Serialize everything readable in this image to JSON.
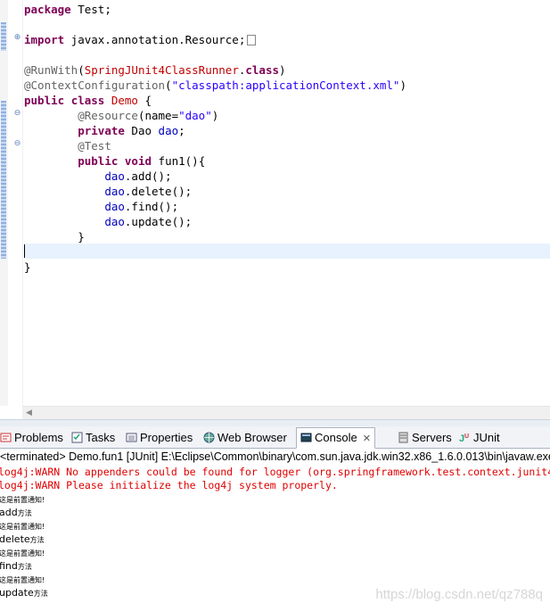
{
  "editor": {
    "lines": [
      {
        "parts": [
          {
            "t": "package",
            "c": "kw"
          },
          {
            "t": " Test;",
            "c": ""
          }
        ]
      },
      {
        "parts": []
      },
      {
        "parts": [
          {
            "t": "import",
            "c": "kw"
          },
          {
            "t": " javax.annotation.Resource;",
            "c": ""
          }
        ],
        "collapsed": true
      },
      {
        "parts": []
      },
      {
        "parts": [
          {
            "t": "@RunWith",
            "c": "an"
          },
          {
            "t": "(",
            "c": ""
          },
          {
            "t": "SpringJUnit4ClassRunner",
            "c": "cls"
          },
          {
            "t": ".",
            "c": ""
          },
          {
            "t": "class",
            "c": "kw"
          },
          {
            "t": ")",
            "c": ""
          }
        ]
      },
      {
        "parts": [
          {
            "t": "@ContextConfiguration",
            "c": "an"
          },
          {
            "t": "(",
            "c": ""
          },
          {
            "t": "\"classpath:applicationContext.xml\"",
            "c": "str"
          },
          {
            "t": ")",
            "c": ""
          }
        ]
      },
      {
        "parts": [
          {
            "t": "public",
            "c": "kw"
          },
          {
            "t": " ",
            "c": ""
          },
          {
            "t": "class",
            "c": "kw"
          },
          {
            "t": " ",
            "c": ""
          },
          {
            "t": "Demo",
            "c": "cls"
          },
          {
            "t": " {",
            "c": ""
          }
        ]
      },
      {
        "parts": [
          {
            "t": "        ",
            "c": ""
          },
          {
            "t": "@Resource",
            "c": "an"
          },
          {
            "t": "(name=",
            "c": ""
          },
          {
            "t": "\"dao\"",
            "c": "str"
          },
          {
            "t": ")",
            "c": ""
          }
        ]
      },
      {
        "parts": [
          {
            "t": "        ",
            "c": ""
          },
          {
            "t": "private",
            "c": "kw"
          },
          {
            "t": " Dao ",
            "c": ""
          },
          {
            "t": "dao",
            "c": "fld"
          },
          {
            "t": ";",
            "c": ""
          }
        ]
      },
      {
        "parts": [
          {
            "t": "        ",
            "c": ""
          },
          {
            "t": "@Test",
            "c": "an"
          }
        ]
      },
      {
        "parts": [
          {
            "t": "        ",
            "c": ""
          },
          {
            "t": "public",
            "c": "kw"
          },
          {
            "t": " ",
            "c": ""
          },
          {
            "t": "void",
            "c": "kw"
          },
          {
            "t": " fun1(){",
            "c": ""
          }
        ]
      },
      {
        "parts": [
          {
            "t": "            ",
            "c": ""
          },
          {
            "t": "dao",
            "c": "fld"
          },
          {
            "t": ".add();",
            "c": ""
          }
        ]
      },
      {
        "parts": [
          {
            "t": "            ",
            "c": ""
          },
          {
            "t": "dao",
            "c": "fld"
          },
          {
            "t": ".delete();",
            "c": ""
          }
        ]
      },
      {
        "parts": [
          {
            "t": "            ",
            "c": ""
          },
          {
            "t": "dao",
            "c": "fld"
          },
          {
            "t": ".find();",
            "c": ""
          }
        ]
      },
      {
        "parts": [
          {
            "t": "            ",
            "c": ""
          },
          {
            "t": "dao",
            "c": "fld"
          },
          {
            "t": ".update();",
            "c": ""
          }
        ]
      },
      {
        "parts": [
          {
            "t": "        }",
            "c": ""
          }
        ]
      },
      {
        "parts": []
      },
      {
        "parts": [
          {
            "t": "}",
            "c": ""
          }
        ]
      }
    ],
    "fold_expand": "⊕",
    "fold_collapse": "⊖"
  },
  "tabs": {
    "problems": "Problems",
    "tasks": "Tasks",
    "properties": "Properties",
    "web_browser": "Web Browser",
    "console": "Console",
    "console_close": "✕",
    "servers": "Servers",
    "junit": "JUnit"
  },
  "console": {
    "header": "<terminated> Demo.fun1 [JUnit] E:\\Eclipse\\Common\\binary\\com.sun.java.jdk.win32.x86_1.6.0.013\\bin\\javaw.exe",
    "warnings": [
      "log4j:WARN No appenders could be found for logger (org.springframework.test.context.junit4",
      "log4j:WARN Please initialize the log4j system properly."
    ],
    "output": [
      {
        "main": "",
        "small": "这是前置通知!"
      },
      {
        "main": "add",
        "small": "方法"
      },
      {
        "main": "",
        "small": "这是前置通知!"
      },
      {
        "main": "delete",
        "small": "方法"
      },
      {
        "main": "",
        "small": "这是前置通知!"
      },
      {
        "main": "find",
        "small": "方法"
      },
      {
        "main": "",
        "small": "这是前置通知!"
      },
      {
        "main": "update",
        "small": "方法"
      }
    ]
  },
  "watermark": "https://blog.csdn.net/qz788q"
}
